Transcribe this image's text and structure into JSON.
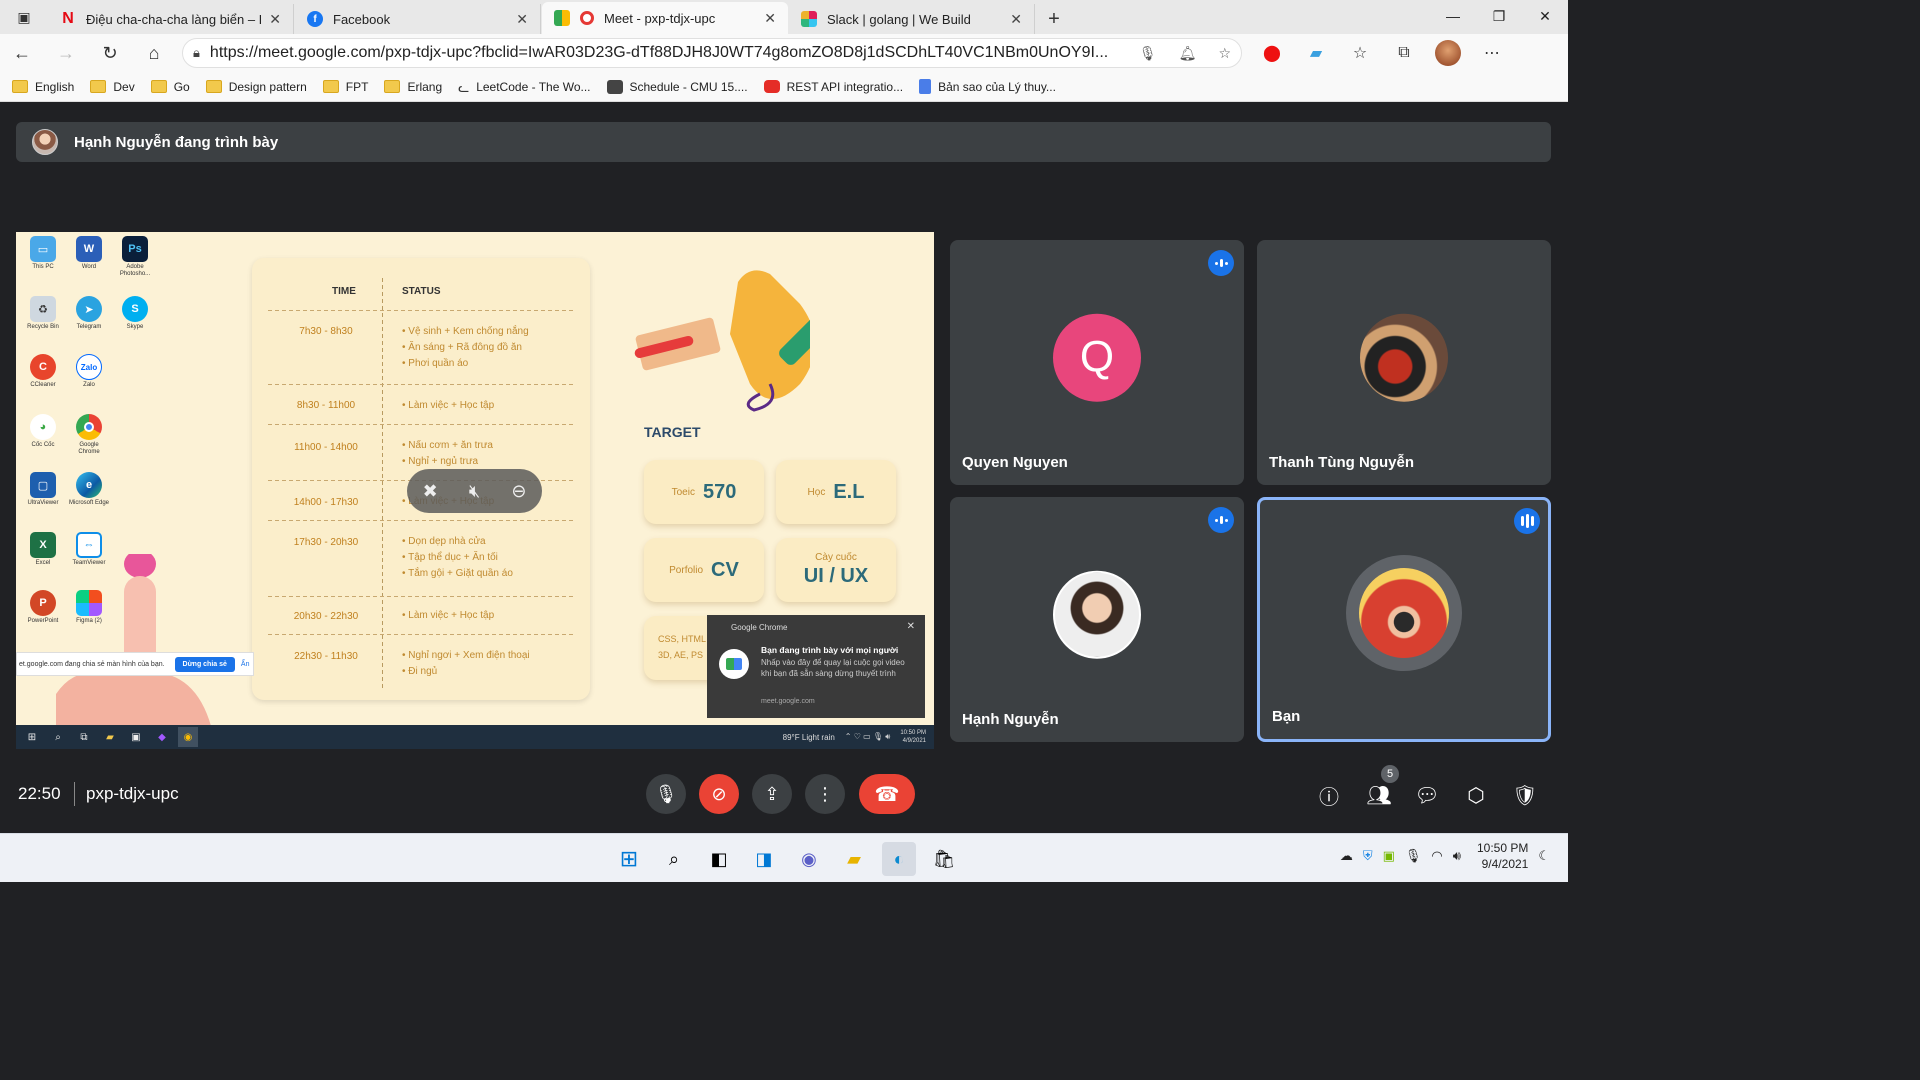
{
  "tabs": [
    {
      "title": "Điệu cha-cha-cha làng biển – Ph",
      "favicon": "netflix-icon"
    },
    {
      "title": "Facebook",
      "favicon": "facebook-icon"
    },
    {
      "title": "Meet - pxp-tdjx-upc",
      "favicon": "meet-icon",
      "active": true
    },
    {
      "title": "Slack | golang | We Build",
      "favicon": "slack-icon"
    }
  ],
  "url": "https://meet.google.com/pxp-tdjx-upc?fbclid=IwAR03D23G-dTf88DJH8J0WT74g8omZO8D8j1dSCDhLT40VC1NBm0UnOY9I...",
  "bookmarks": [
    "English",
    "Dev",
    "Go",
    "Design pattern",
    "FPT",
    "Erlang",
    "LeetCode - The Wo...",
    "Schedule - CMU 15....",
    "REST API integratio...",
    "Bản sao của Lý thuy..."
  ],
  "presenter_banner": "Hạnh Nguyễn đang trình bày",
  "shared_screen": {
    "desktop_icons": [
      "This PC",
      "Word",
      "Adobe Photosho...",
      "Recycle Bin",
      "Telegram",
      "Skype",
      "CCleaner",
      "Zalo",
      "Cốc Cốc",
      "Google Chrome",
      "UltraViewer",
      "Microsoft Edge",
      "Excel",
      "TeamViewer",
      "PowerPoint",
      "Figma (2)"
    ],
    "timetable": {
      "headers": [
        "TIME",
        "STATUS"
      ],
      "rows": [
        {
          "time": "7h30 - 8h30",
          "items": [
            "Vệ sinh + Kem chống nắng",
            "Ăn sáng + Rã đông đồ ăn",
            "Phơi quần áo"
          ]
        },
        {
          "time": "8h30 - 11h00",
          "items": [
            "Làm việc + Học tập"
          ]
        },
        {
          "time": "11h00 - 14h00",
          "items": [
            "Nấu cơm + ăn trưa",
            "Nghỉ + ngủ trưa"
          ]
        },
        {
          "time": "14h00 - 17h30",
          "items": [
            "Làm việc + Học tập"
          ]
        },
        {
          "time": "17h30 - 20h30",
          "items": [
            "Dọn dẹp nhà cửa",
            "Tập thể dục + Ăn tối",
            "Tắm gội + Giặt quần áo"
          ]
        },
        {
          "time": "20h30 - 22h30",
          "items": [
            "Làm việc + Học tập"
          ]
        },
        {
          "time": "22h30 - 11h30",
          "items": [
            "Nghỉ ngơi + Xem điện thoại",
            "Đi ngủ"
          ]
        }
      ]
    },
    "target_heading": "TARGET",
    "targets": [
      {
        "key": "Toeic",
        "value": "570"
      },
      {
        "key": "Học",
        "value": "E.L"
      },
      {
        "key": "Porfolio",
        "value": "CV"
      },
      {
        "key": "Cày cuốc",
        "value": "UI / UX"
      },
      {
        "key": "CSS, HTML",
        "value": "3D, AE, PS"
      }
    ],
    "chrome_notification": {
      "app": "Google Chrome",
      "title": "Bạn đang trình bày với mọi người",
      "body": "Nhấp vào đây để quay lại cuộc gọi video khi bạn đã sẵn sàng dừng thuyết trình",
      "source": "meet.google.com"
    },
    "share_bar": {
      "text": "et.google.com đang chia sẻ màn hình của bạn.",
      "stop": "Dừng chia sẻ",
      "hide": "Ẩn"
    },
    "inner_tray": {
      "weather": "89°F  Light rain",
      "time": "10:50 PM",
      "date": "4/9/2021"
    }
  },
  "participants": [
    {
      "name": "Quyen Nguyen",
      "initial": "Q"
    },
    {
      "name": "Thanh Tùng Nguyễn"
    },
    {
      "name": "Hạnh Nguyễn"
    },
    {
      "name": "Bạn"
    }
  ],
  "bottom_bar": {
    "time": "22:50",
    "meeting_code": "pxp-tdjx-upc",
    "participant_count": "5"
  },
  "taskbar": {
    "time": "10:50 PM",
    "date": "9/4/2021"
  }
}
